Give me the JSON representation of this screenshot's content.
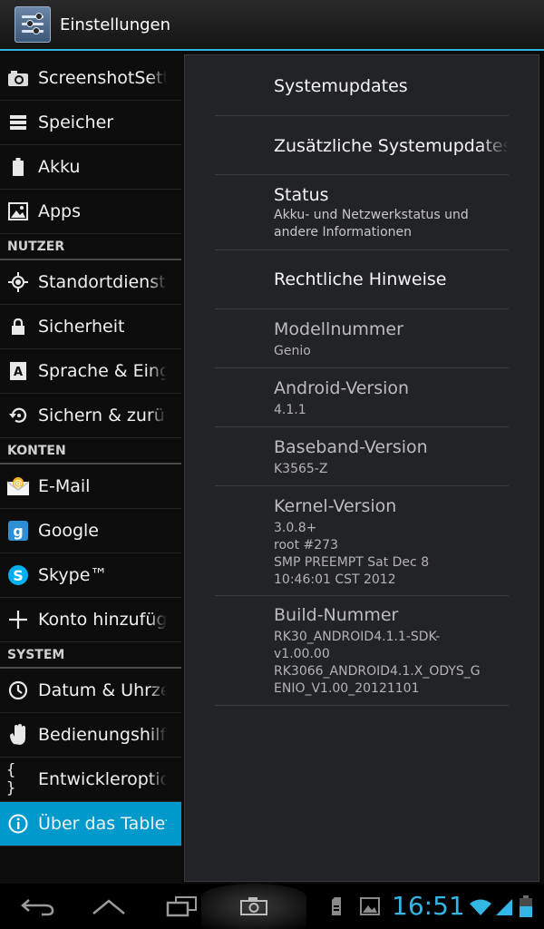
{
  "actionbar": {
    "title": "Einstellungen"
  },
  "left_list": [
    {
      "type": "row",
      "label": "ScreenshotSettings",
      "icon": "camera-icon"
    },
    {
      "type": "row",
      "label": "Speicher",
      "icon": "storage-icon"
    },
    {
      "type": "row",
      "label": "Akku",
      "icon": "battery-icon"
    },
    {
      "type": "row",
      "label": "Apps",
      "icon": "apps-icon"
    },
    {
      "type": "header",
      "label": "NUTZER"
    },
    {
      "type": "row",
      "label": "Standortdienste",
      "icon": "location-icon"
    },
    {
      "type": "row",
      "label": "Sicherheit",
      "icon": "lock-icon"
    },
    {
      "type": "row",
      "label": "Sprache & Eingabe",
      "icon": "language-icon"
    },
    {
      "type": "row",
      "label": "Sichern & zurücksetzen",
      "icon": "backup-icon"
    },
    {
      "type": "header",
      "label": "KONTEN"
    },
    {
      "type": "row",
      "label": "E-Mail",
      "icon": "email-icon"
    },
    {
      "type": "row",
      "label": "Google",
      "icon": "google-icon"
    },
    {
      "type": "row",
      "label": "Skype™",
      "icon": "skype-icon"
    },
    {
      "type": "row",
      "label": "Konto hinzufügen",
      "icon": "add-icon"
    },
    {
      "type": "header",
      "label": "SYSTEM"
    },
    {
      "type": "row",
      "label": "Datum & Uhrzeit",
      "icon": "clock-icon"
    },
    {
      "type": "row",
      "label": "Bedienungshilfen",
      "icon": "hand-icon"
    },
    {
      "type": "row",
      "label": "Entwickleroptionen",
      "icon": "braces-icon"
    },
    {
      "type": "row",
      "label": "Über das Tablet",
      "icon": "info-icon",
      "active": true
    }
  ],
  "about": {
    "system_updates": {
      "title": "Systemupdates"
    },
    "extra_updates": {
      "title": "Zusätzliche Systemupdates"
    },
    "status": {
      "title": "Status",
      "summary": "Akku- und Netzwerkstatus und andere Informationen"
    },
    "legal": {
      "title": "Rechtliche Hinweise"
    },
    "model": {
      "title": "Modellnummer",
      "value": "Genio"
    },
    "android": {
      "title": "Android-Version",
      "value": "4.1.1"
    },
    "baseband": {
      "title": "Baseband-Version",
      "value": "K3565-Z"
    },
    "kernel": {
      "title": "Kernel-Version",
      "lines": [
        "3.0.8+",
        "root #273",
        "SMP PREEMPT Sat Dec 8",
        "10:46:01 CST 2012"
      ]
    },
    "build": {
      "title": "Build-Nummer",
      "lines": [
        "RK30_ANDROID4.1.1-SDK-",
        "v1.00.00",
        "RK3066_ANDROID4.1.X_ODYS_G",
        "ENIO_V1.00_20121101"
      ]
    }
  },
  "systembar": {
    "time": "16:51"
  },
  "colors": {
    "accent": "#33b5e5",
    "selected": "#0099cc",
    "panel": "#222326"
  }
}
